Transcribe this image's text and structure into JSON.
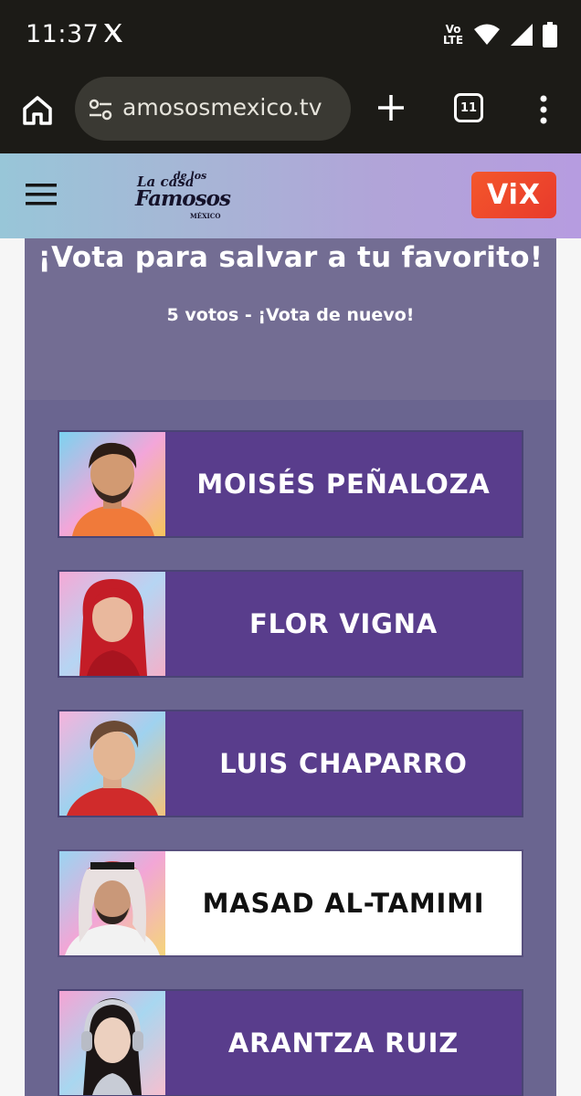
{
  "status_bar": {
    "time": "11:37",
    "volte_top": "Vo",
    "volte_bottom": "LTE"
  },
  "browser": {
    "url": "amososmexico.tv",
    "tab_count": "11"
  },
  "site": {
    "logo": {
      "line1": "La casa",
      "line2": "de los",
      "line3": "Famosos",
      "line4": "MÉXICO"
    },
    "vix_label": "ViX"
  },
  "vote": {
    "title": "¡Vota para salvar a tu favorito!",
    "count_text": "5 votos - ¡Vota de nuevo!"
  },
  "contestants": [
    {
      "name": "MOISÉS PEÑALOZA",
      "selected": false
    },
    {
      "name": "FLOR VIGNA",
      "selected": false
    },
    {
      "name": "LUIS CHAPARRO",
      "selected": false
    },
    {
      "name": "MASAD AL-TAMIMI",
      "selected": true
    },
    {
      "name": "ARANTZA RUIZ",
      "selected": false
    }
  ],
  "colors": {
    "status_bg": "#1c1b17",
    "card_bg": "#706b8f",
    "contestant_bg": "#593d8c",
    "selected_bg": "#ffffff",
    "vix_red": "#e83a2c"
  }
}
